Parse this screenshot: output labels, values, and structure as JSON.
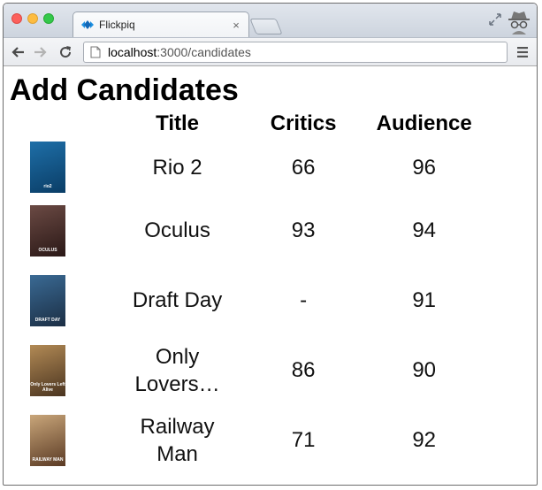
{
  "browser": {
    "tab_title": "Flickpiq",
    "tab_close": "×",
    "url_host": "localhost",
    "url_rest": ":3000/candidates"
  },
  "page": {
    "heading": "Add Candidates",
    "columns": {
      "title": "Title",
      "critics": "Critics",
      "audience": "Audience"
    },
    "movies": [
      {
        "title": "Rio 2",
        "critics": "66",
        "audience": "96",
        "poster_text": "rio2",
        "poster_colors": [
          "#1e6fa8",
          "#0a3d66"
        ]
      },
      {
        "title": "Oculus",
        "critics": "93",
        "audience": "94",
        "poster_text": "OCULUS",
        "poster_colors": [
          "#6b4a44",
          "#2a1816"
        ]
      },
      {
        "title": "Draft Day",
        "critics": "-",
        "audience": "91",
        "poster_text": "DRAFT DAY",
        "poster_colors": [
          "#3a6a94",
          "#1b2e44"
        ]
      },
      {
        "title": "Only Lovers…",
        "critics": "86",
        "audience": "90",
        "poster_text": "Only Lovers Left Alive",
        "poster_colors": [
          "#b28a55",
          "#4a3420"
        ]
      },
      {
        "title": "Railway Man",
        "critics": "71",
        "audience": "92",
        "poster_text": "RAILWAY MAN",
        "poster_colors": [
          "#c9a67a",
          "#5a3a24"
        ]
      }
    ]
  }
}
